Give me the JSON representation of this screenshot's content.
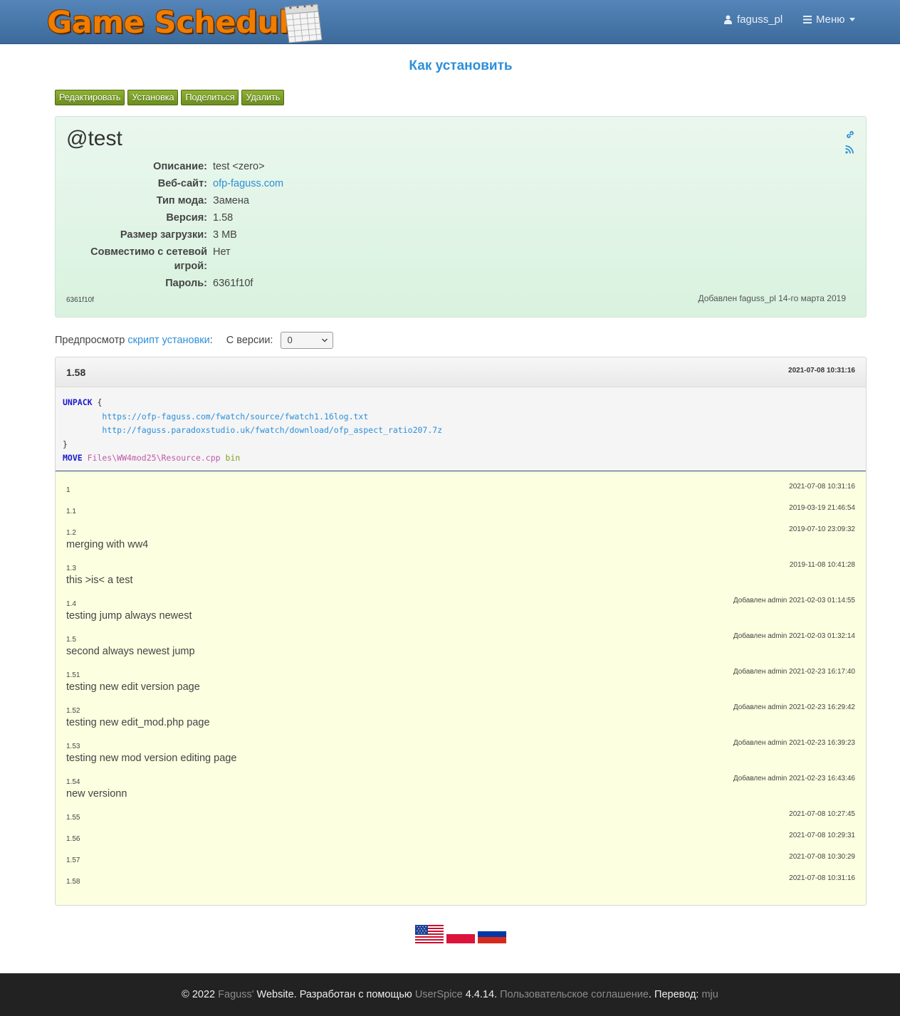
{
  "navbar": {
    "logo_text": "Game Schedule",
    "user": "faguss_pl",
    "menu_label": "Меню"
  },
  "page_title": "Как установить",
  "actions": {
    "edit": "Редактировать",
    "install": "Установка",
    "share": "Поделиться",
    "delete": "Удалить"
  },
  "mod": {
    "name": "@test",
    "fields": [
      {
        "label": "Описание:",
        "value": "test <zero>"
      },
      {
        "label": "Веб-сайт:",
        "value": "ofp-faguss.com"
      },
      {
        "label": "Тип мода:",
        "value": "Замена"
      },
      {
        "label": "Версия:",
        "value": "1.58"
      },
      {
        "label": "Размер загрузки:",
        "value": "3 MB"
      },
      {
        "label": "Совместимо с сетевой игрой:",
        "value": "Нет"
      },
      {
        "label": "Пароль:",
        "value": "6361f10f"
      }
    ],
    "password_small": "6361f10f",
    "added_by": "Добавлен faguss_pl 14-го марта 2019"
  },
  "preview": {
    "prefix": "Предпросмотр",
    "link": "скрипт установки",
    "colon": ":",
    "from_version_label": "С версии:",
    "from_version_value": "0"
  },
  "current_version": {
    "number": "1.58",
    "date": "2021-07-08 10:31:16",
    "script": {
      "kw_unpack": "UNPACK",
      "brace_open": "{",
      "url1": "https://ofp-faguss.com/fwatch/source/fwatch1.16log.txt",
      "url2": "http://faguss.paradoxstudio.uk/fwatch/download/ofp_aspect_ratio207.7z",
      "brace_close": "}",
      "kw_move": "MOVE",
      "move_path": "Files\\WW4mod25\\Resource.cpp",
      "move_arg": "bin"
    }
  },
  "history": [
    {
      "version": "1",
      "date": "2021-07-08 10:31:16",
      "note": ""
    },
    {
      "version": "1.1",
      "date": "2019-03-19 21:46:54",
      "note": ""
    },
    {
      "version": "1.2",
      "date": "2019-07-10 23:09:32",
      "note": "merging with ww4"
    },
    {
      "version": "1.3",
      "date": "2019-11-08 10:41:28",
      "note": "this >is< a test"
    },
    {
      "version": "1.4",
      "date": "Добавлен admin 2021-02-03 01:14:55",
      "note": "testing jump always newest"
    },
    {
      "version": "1.5",
      "date": "Добавлен admin 2021-02-03 01:32:14",
      "note": "second always newest jump"
    },
    {
      "version": "1.51",
      "date": "Добавлен admin 2021-02-23 16:17:40",
      "note": "testing new edit version page"
    },
    {
      "version": "1.52",
      "date": "Добавлен admin 2021-02-23 16:29:42",
      "note": "testing new edit_mod.php page"
    },
    {
      "version": "1.53",
      "date": "Добавлен admin 2021-02-23 16:39:23",
      "note": "testing new mod version editing page"
    },
    {
      "version": "1.54",
      "date": "Добавлен admin 2021-02-23 16:43:46",
      "note": "new versionn"
    },
    {
      "version": "1.55",
      "date": "2021-07-08 10:27:45",
      "note": ""
    },
    {
      "version": "1.56",
      "date": "2021-07-08 10:29:31",
      "note": ""
    },
    {
      "version": "1.57",
      "date": "2021-07-08 10:30:29",
      "note": ""
    },
    {
      "version": "1.58",
      "date": "2021-07-08 10:31:16",
      "note": ""
    }
  ],
  "flags": [
    "us-flag-icon",
    "pl-flag-icon",
    "ru-flag-icon"
  ],
  "footer": {
    "copyright": "© 2022",
    "author_link": "Faguss'",
    "text1": "Website. Разработан с помощью",
    "userspice_link": "UserSpice",
    "version": "4.4.14.",
    "agreement_link": "Пользовательское соглашение",
    "translation_label": ". Перевод:",
    "translator_link": "mju"
  },
  "colors": {
    "nav_bg": "#4a79ab",
    "link": "#2c8fd9",
    "button_green": "#7a9c25",
    "info_bg": "#e0f4e5",
    "history_bg": "#fcffe0",
    "footer_bg": "#222222"
  }
}
